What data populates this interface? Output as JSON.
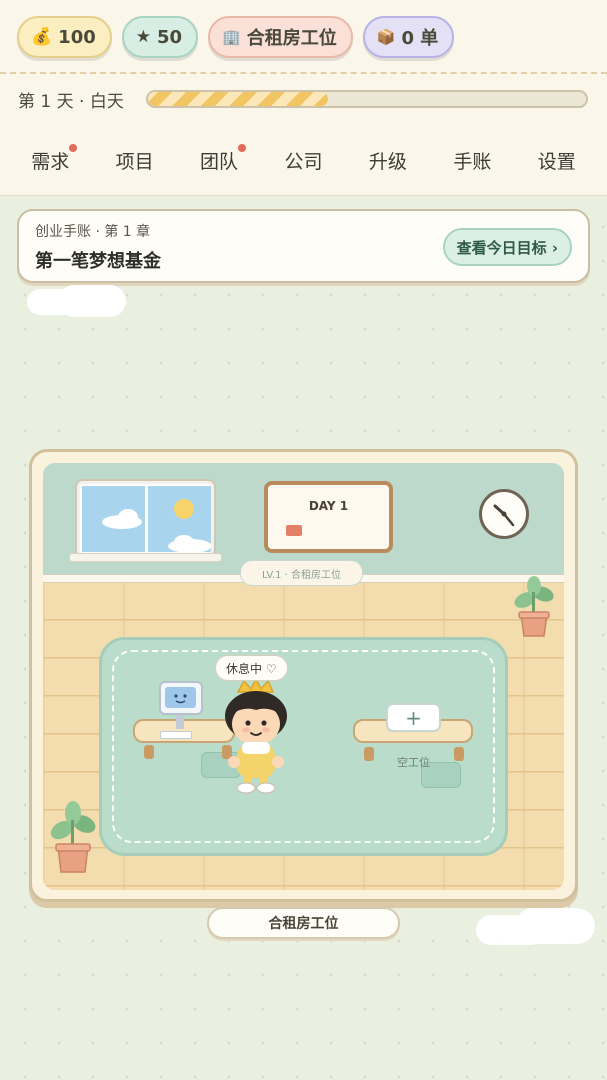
{
  "resources": {
    "money": {
      "icon": "money-bag-icon",
      "glyph": "💰",
      "value": "100"
    },
    "reputation": {
      "icon": "star-icon",
      "glyph": "★",
      "value": "50"
    },
    "workplace": {
      "icon": "building-icon",
      "glyph": "🏢",
      "value": "合租房工位"
    },
    "orders": {
      "icon": "package-icon",
      "glyph": "📦",
      "value": "0 单"
    }
  },
  "day": {
    "label": "第 1 天 · 白天",
    "progress": 0.41
  },
  "nav": {
    "items": [
      {
        "label": "需求",
        "badge": true
      },
      {
        "label": "项目",
        "badge": false
      },
      {
        "label": "团队",
        "badge": true
      },
      {
        "label": "公司",
        "badge": false
      },
      {
        "label": "升级",
        "badge": false
      },
      {
        "label": "手账",
        "badge": false
      },
      {
        "label": "设置",
        "badge": false
      }
    ]
  },
  "journal": {
    "chapter": "创业手账 · 第 1 章",
    "title": "第一笔梦想基金",
    "goal_button": "查看今日目标 ›"
  },
  "room": {
    "board_text": "DAY 1",
    "level_sign": "LV.1 · 合租房工位",
    "status_bubble": "休息中 ♡",
    "add_seat": "+",
    "empty_seat_label": "空工位",
    "name_button": "合租房工位"
  },
  "colors": {
    "background": "#e9f0df",
    "header": "#fbf6ea",
    "wall": "#bcd9cc",
    "floor": "#f3dcae",
    "rug": "#b9dccb",
    "badge": "#e36a5b",
    "progress": "#f1c562"
  }
}
